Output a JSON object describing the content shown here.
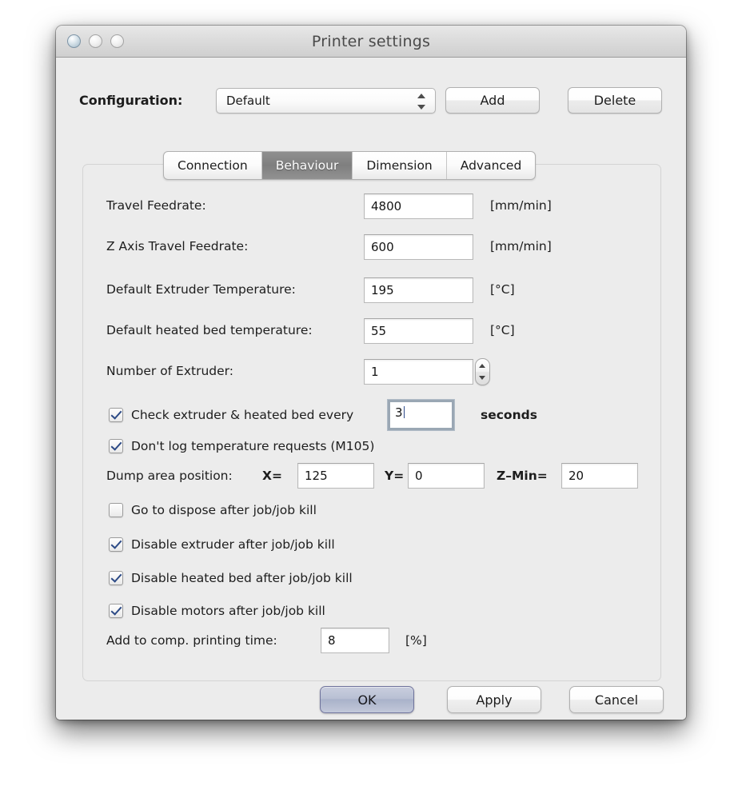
{
  "window": {
    "title": "Printer settings",
    "traffic_lights": [
      "close",
      "minimize",
      "zoom"
    ]
  },
  "config": {
    "label": "Configuration:",
    "selected": "Default",
    "add_label": "Add",
    "delete_label": "Delete"
  },
  "tabs": [
    {
      "label": "Connection",
      "active": false
    },
    {
      "label": "Behaviour",
      "active": true
    },
    {
      "label": "Dimension",
      "active": false
    },
    {
      "label": "Advanced",
      "active": false
    }
  ],
  "behaviour": {
    "fields": [
      {
        "label": "Travel Feedrate:",
        "value": "4800",
        "unit": "[mm/min]"
      },
      {
        "label": "Z Axis Travel Feedrate:",
        "value": "600",
        "unit": "[mm/min]"
      },
      {
        "label": "Default Extruder Temperature:",
        "value": "195",
        "unit": "[°C]"
      },
      {
        "label": "Default heated bed temperature:",
        "value": "55",
        "unit": "[°C]"
      }
    ],
    "extruder": {
      "label": "Number of Extruder:",
      "value": "1"
    },
    "check_interval": {
      "checked": true,
      "label": "Check extruder & heated bed every",
      "value": "3",
      "suffix": "seconds"
    },
    "dont_log": {
      "checked": true,
      "label": "Don't log temperature requests (M105)"
    },
    "dump_area": {
      "label": "Dump area position:",
      "x_label": "X=",
      "x_value": "125",
      "y_label": "Y=",
      "y_value": "0",
      "z_label": "Z–Min=",
      "z_value": "20"
    },
    "checkboxes": [
      {
        "checked": false,
        "label": "Go to dispose after job/job kill"
      },
      {
        "checked": true,
        "label": "Disable extruder after job/job kill"
      },
      {
        "checked": true,
        "label": "Disable heated bed after job/job kill"
      },
      {
        "checked": true,
        "label": "Disable motors after job/job kill"
      }
    ],
    "comp_time": {
      "label": "Add to comp. printing time:",
      "value": "8",
      "unit": "[%]"
    }
  },
  "footer": {
    "ok_label": "OK",
    "apply_label": "Apply",
    "cancel_label": "Cancel"
  }
}
